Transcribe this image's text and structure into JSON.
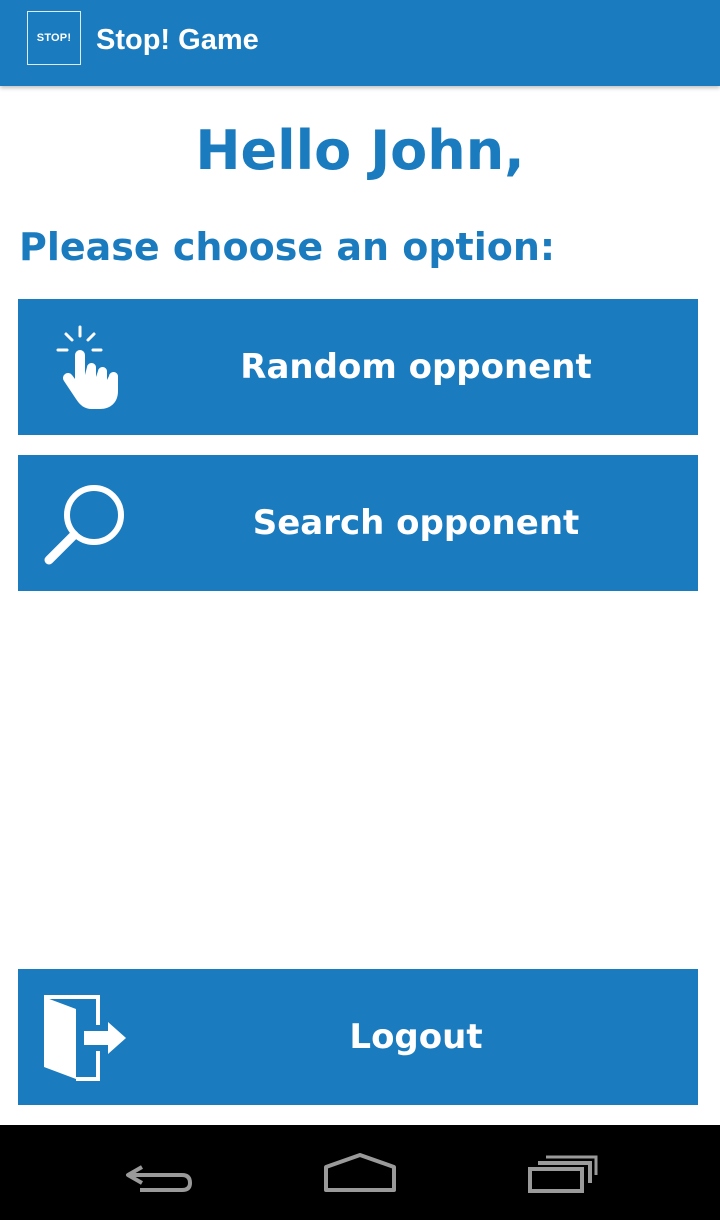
{
  "app_bar": {
    "logo_text": "STOP!",
    "title": "Stop! Game",
    "color": "#1a7bbf"
  },
  "greeting": "Hello John,",
  "prompt": "Please choose an option:",
  "options": [
    {
      "label": "Random opponent",
      "icon": "tap-hand-icon"
    },
    {
      "label": "Search opponent",
      "icon": "search-icon"
    }
  ],
  "logout": {
    "label": "Logout",
    "icon": "logout-door-icon"
  },
  "nav_bar": {
    "back_icon": "back-icon",
    "home_icon": "home-icon",
    "recents_icon": "recents-icon"
  }
}
